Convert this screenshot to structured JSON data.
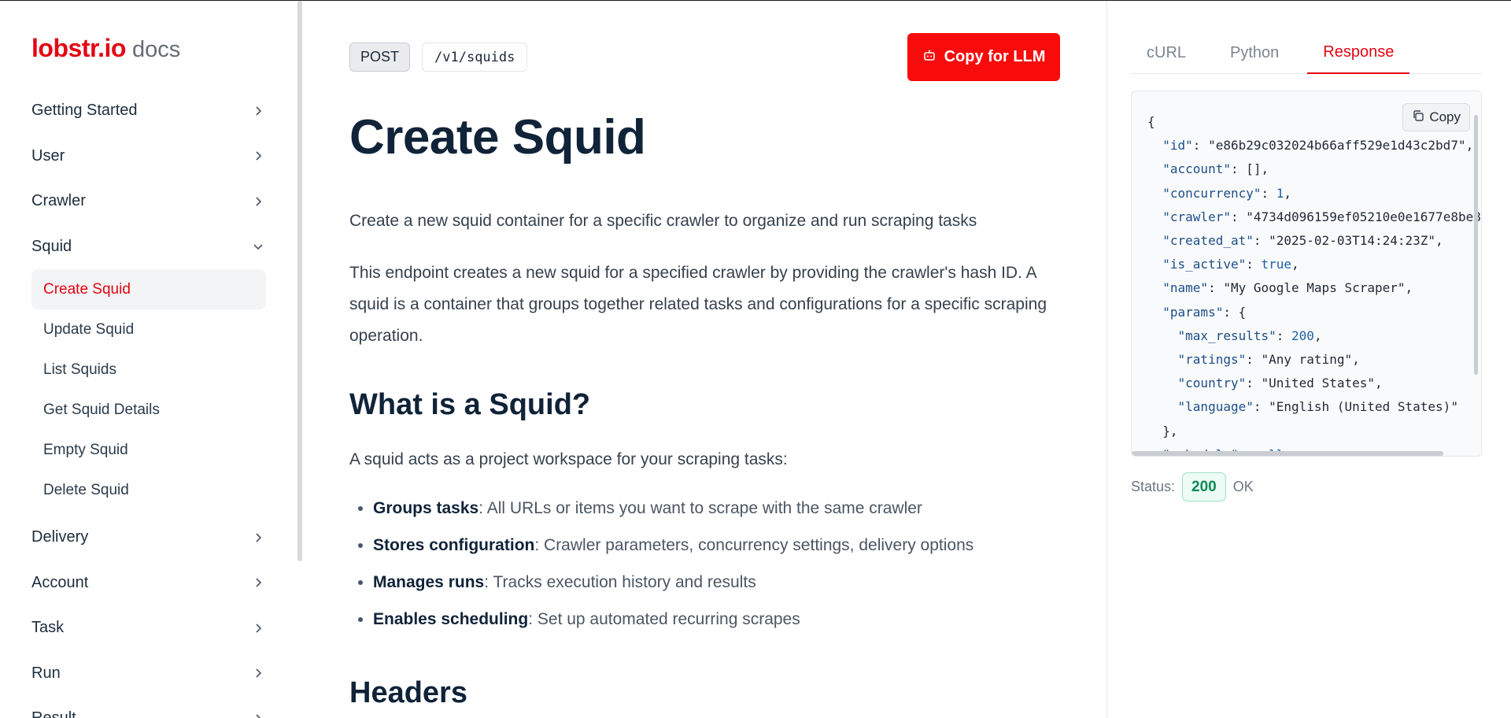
{
  "brand": {
    "name": "lobstr.io",
    "suffix": "docs"
  },
  "sidebar": {
    "items": [
      {
        "label": "Getting Started"
      },
      {
        "label": "User"
      },
      {
        "label": "Crawler"
      },
      {
        "label": "Squid"
      },
      {
        "label": "Delivery"
      },
      {
        "label": "Account"
      },
      {
        "label": "Task"
      },
      {
        "label": "Run"
      },
      {
        "label": "Result"
      }
    ],
    "squid_children": [
      {
        "label": "Create Squid"
      },
      {
        "label": "Update Squid"
      },
      {
        "label": "List Squids"
      },
      {
        "label": "Get Squid Details"
      },
      {
        "label": "Empty Squid"
      },
      {
        "label": "Delete Squid"
      }
    ]
  },
  "endpoint": {
    "method": "POST",
    "path": "/v1/squids",
    "copy_llm_label": "Copy for LLM"
  },
  "page": {
    "title": "Create Squid",
    "intro": "Create a new squid container for a specific crawler to organize and run scraping tasks",
    "description": "This endpoint creates a new squid for a specified crawler by providing the crawler's hash ID. A squid is a container that groups together related tasks and configurations for a specific scraping operation.",
    "section1_title": "What is a Squid?",
    "section1_lead": "A squid acts as a project workspace for your scraping tasks:",
    "bullets": [
      {
        "term": "Groups tasks",
        "text": ": All URLs or items you want to scrape with the same crawler"
      },
      {
        "term": "Stores configuration",
        "text": ": Crawler parameters, concurrency settings, delivery options"
      },
      {
        "term": "Manages runs",
        "text": ": Tracks execution history and results"
      },
      {
        "term": "Enables scheduling",
        "text": ": Set up automated recurring scrapes"
      }
    ],
    "section2_title": "Headers"
  },
  "response_panel": {
    "tabs": [
      "cURL",
      "Python",
      "Response"
    ],
    "active_tab": "Response",
    "copy_label": "Copy",
    "code_lines": [
      "{",
      "  \"id\": \"e86b29c032024b66aff529e1d43c2bd7\",",
      "  \"account\": [],",
      "  \"concurrency\": 1,",
      "  \"crawler\": \"4734d096159ef05210e0e1677e8be8",
      "  \"created_at\": \"2025-02-03T14:24:23Z\",",
      "  \"is_active\": true,",
      "  \"name\": \"My Google Maps Scraper\",",
      "  \"params\": {",
      "    \"max_results\": 200,",
      "    \"ratings\": \"Any rating\",",
      "    \"country\": \"United States\",",
      "    \"language\": \"English (United States)\"",
      "  },",
      "  \"schedule\": null"
    ],
    "status_label": "Status:",
    "status_code": "200",
    "status_text": "OK"
  },
  "colors": {
    "brand": "#e30613",
    "accent_button": "#f80b0b",
    "status_ok": "#0b8a58",
    "heading": "#102338"
  },
  "icons": {
    "chevron_right": "chevron-right-icon",
    "chevron_down": "chevron-down-icon",
    "robot": "robot-icon",
    "copy": "copy-icon"
  }
}
